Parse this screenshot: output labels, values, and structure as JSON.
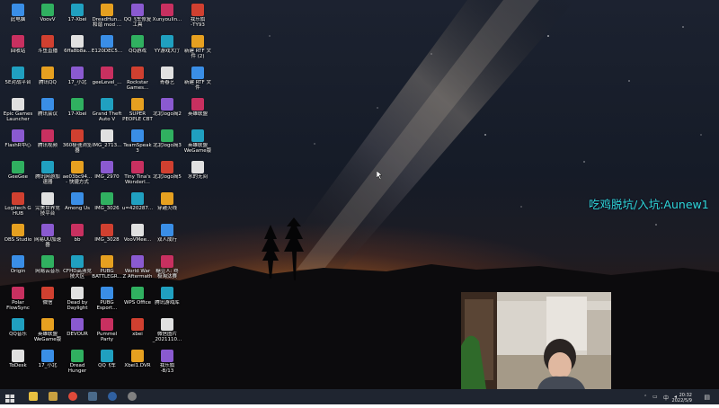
{
  "desktop": {
    "icons": [
      [
        "此电脑",
        "VoovV",
        "17-Xbei",
        "DreadHun...\n和谐 mod ...",
        "QQ飞车修复\n工具",
        "Xunyoulin...",
        "我乐旗\n-TY93"
      ],
      [
        "回收站",
        "斗鱼直播",
        "6ffa8b8a...",
        "E120DEC5...",
        "QQ游戏",
        "YY游戏大厅",
        "新建 RTF 文\n件 (2)"
      ],
      [
        "5E对战平台",
        "腾讯QQ",
        "17_小北",
        "geeLevel_...",
        "Rockstar\nGames...",
        "青春艺",
        "新建 RTF 文\n件"
      ],
      [
        "Epic Games\nLauncher",
        "腾讯会议",
        "17-Xbei",
        "Grand Theft\nAuto V",
        "SUPER\nPEOPLE CBT",
        "北北logo简2",
        "英雄联盟"
      ],
      [
        "FlashR中心",
        "腾讯视频",
        "360极速浏览\n器",
        "IMG_2713...",
        "TeamSpeak\n3",
        "北北logo简3",
        "英雄联盟\nWeGame版"
      ],
      [
        "GeeGee",
        "腾讯网游加\n速器",
        "ae03bc94...\n- 快捷方式",
        "IMG_2970",
        "Tiny Tina's\nWonderl...",
        "北北logo简5",
        "水的无间"
      ],
      [
        "Logitech G\nHUB",
        "完美世界竞\n技平台",
        "Among Us",
        "IMG_3026",
        "u=420287...",
        "穿越火线",
        ""
      ],
      [
        "OBS Studio",
        "网易UU加速\n器",
        "bb",
        "IMG_3028",
        "VooVMee...",
        "双人成行",
        ""
      ],
      [
        "Origin",
        "网易云音乐",
        "CFHD高清竞\n技大区",
        "PUBG\nBATTLEGR...",
        "World War\nZ Aftermath",
        "糖豆人: 终\n极淘汰赛",
        ""
      ],
      [
        "Polar\nFlowSync",
        "微信",
        "Dead by\nDaylight",
        "PUBG\nEsport...",
        "WPS Office",
        "腾讯游戏库",
        ""
      ],
      [
        "QQ音乐",
        "英雄联盟\nWeGame版",
        "DEVOUR",
        "Pummel\nParty",
        "xbei",
        "微信图片\n_2021110...",
        ""
      ],
      [
        "ToDesk",
        "17_小北",
        "Dread\nHunger",
        "QQ飞车",
        "Xbei1.DVR",
        "我乐旗\n-B/13",
        ""
      ]
    ],
    "overlay_text": "吃鸡脱坑/入坑:Aunew1"
  },
  "taskbar": {
    "clock_time": "20:32",
    "clock_date": "2022/5/9",
    "tray_lang": "中",
    "apps": [
      "explorer",
      "lol",
      "chrome",
      "steam",
      "obs",
      "obs2"
    ]
  },
  "colors": {
    "accent_overlay": "#2fd8d6",
    "taskbar_bg": "#1f2530",
    "icon_colors": [
      "#3a8ee6",
      "#e6a020",
      "#d04030",
      "#30b060",
      "#8a5ad0",
      "#e0e0e0",
      "#20a0c0",
      "#c83060"
    ]
  }
}
